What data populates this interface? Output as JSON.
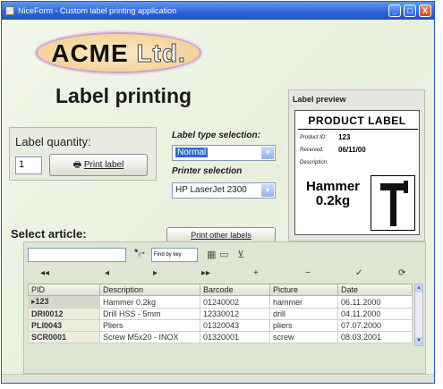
{
  "window": {
    "title": "NiceForm - Custom label printing application",
    "controls": [
      "_",
      "□",
      "X"
    ]
  },
  "logo": {
    "main": "ACME",
    "suffix": "Ltd."
  },
  "heading": "Label printing",
  "quantity": {
    "label": "Label quantity:",
    "value": "1",
    "print_button": "Print label",
    "print_icon": "printer-icon"
  },
  "label_type": {
    "label": "Label type selection:",
    "value": "Normal"
  },
  "printer": {
    "label": "Printer selection",
    "value": "HP LaserJet 2300"
  },
  "other_labels_button": "Print other labels",
  "preview": {
    "title": "Label preview",
    "heading": "PRODUCT LABEL",
    "fields": [
      {
        "key": "Product ID:",
        "value": "123"
      },
      {
        "key": "Received:",
        "value": "06/11/00"
      },
      {
        "key": "Description:",
        "value": ""
      }
    ],
    "product_name": "Hammer",
    "product_weight": "0.2kg",
    "picture_icon": "hammer-icon"
  },
  "articles": {
    "heading": "Select article:",
    "search_value": "",
    "find_by": "Find by key",
    "columns": [
      "PID",
      "Description",
      "Barcode",
      "Picture",
      "Date"
    ],
    "rows": [
      {
        "pid": "123",
        "description": "Hammer 0.2kg",
        "barcode": "01240002",
        "picture": "hammer",
        "date": "06.11.2000"
      },
      {
        "pid": "DRI0012",
        "description": "Drill HSS - 5mm",
        "barcode": "12330012",
        "picture": "drill",
        "date": "04.11.2000"
      },
      {
        "pid": "PLI0043",
        "description": "Pliers",
        "barcode": "01320043",
        "picture": "pliers",
        "date": "07.07.2000"
      },
      {
        "pid": "SCR0001",
        "description": "Screw M5x20 - INOX",
        "barcode": "01320001",
        "picture": "screw",
        "date": "08.03.2001"
      }
    ],
    "nav_buttons": [
      "◂◂",
      "◂",
      "▸",
      "▸▸",
      "+",
      "−",
      "✓",
      "⟳"
    ]
  }
}
